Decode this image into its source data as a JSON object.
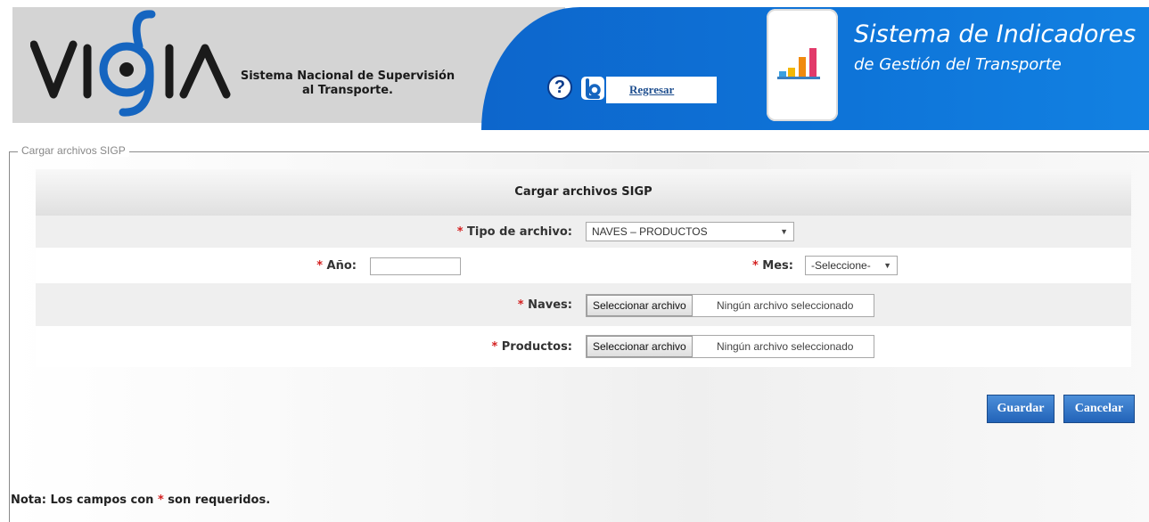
{
  "header": {
    "org_name": "Sistema Nacional de Supervisión al Transporte.",
    "org_name_line1": "Sistema Nacional de Supervisión",
    "org_name_line2": "al Transporte.",
    "logo_text": "VIGIA",
    "back_link": "Regresar",
    "help_symbol": "?",
    "app_title": "Sistema de Indicadores",
    "app_subtitle": "de Gestión del Transporte",
    "colors": {
      "gray": "#d4d4d4",
      "blue": "#0e74d8"
    }
  },
  "fieldset": {
    "legend": "Cargar archivos SIGP"
  },
  "form": {
    "title": "Cargar archivos SIGP",
    "required_mark": "*",
    "tipo_archivo": {
      "label": "Tipo de archivo:",
      "value": "NAVES – PRODUCTOS"
    },
    "anio": {
      "label": "Año:",
      "value": ""
    },
    "mes": {
      "label": "Mes:",
      "value": "-Seleccione-"
    },
    "naves": {
      "label": "Naves:",
      "button": "Seleccionar archivo",
      "status": "Ningún archivo seleccionado"
    },
    "productos": {
      "label": "Productos:",
      "button": "Seleccionar archivo",
      "status": "Ningún archivo seleccionado"
    }
  },
  "actions": {
    "save": "Guardar",
    "cancel": "Cancelar",
    "button_color": "#2263b8"
  },
  "note": {
    "prefix": "Nota: Los campos con",
    "mark": "*",
    "suffix": "son requeridos."
  },
  "icons": [
    "help-icon",
    "back-icon",
    "chart-icon",
    "dropdown-arrow-icon"
  ]
}
